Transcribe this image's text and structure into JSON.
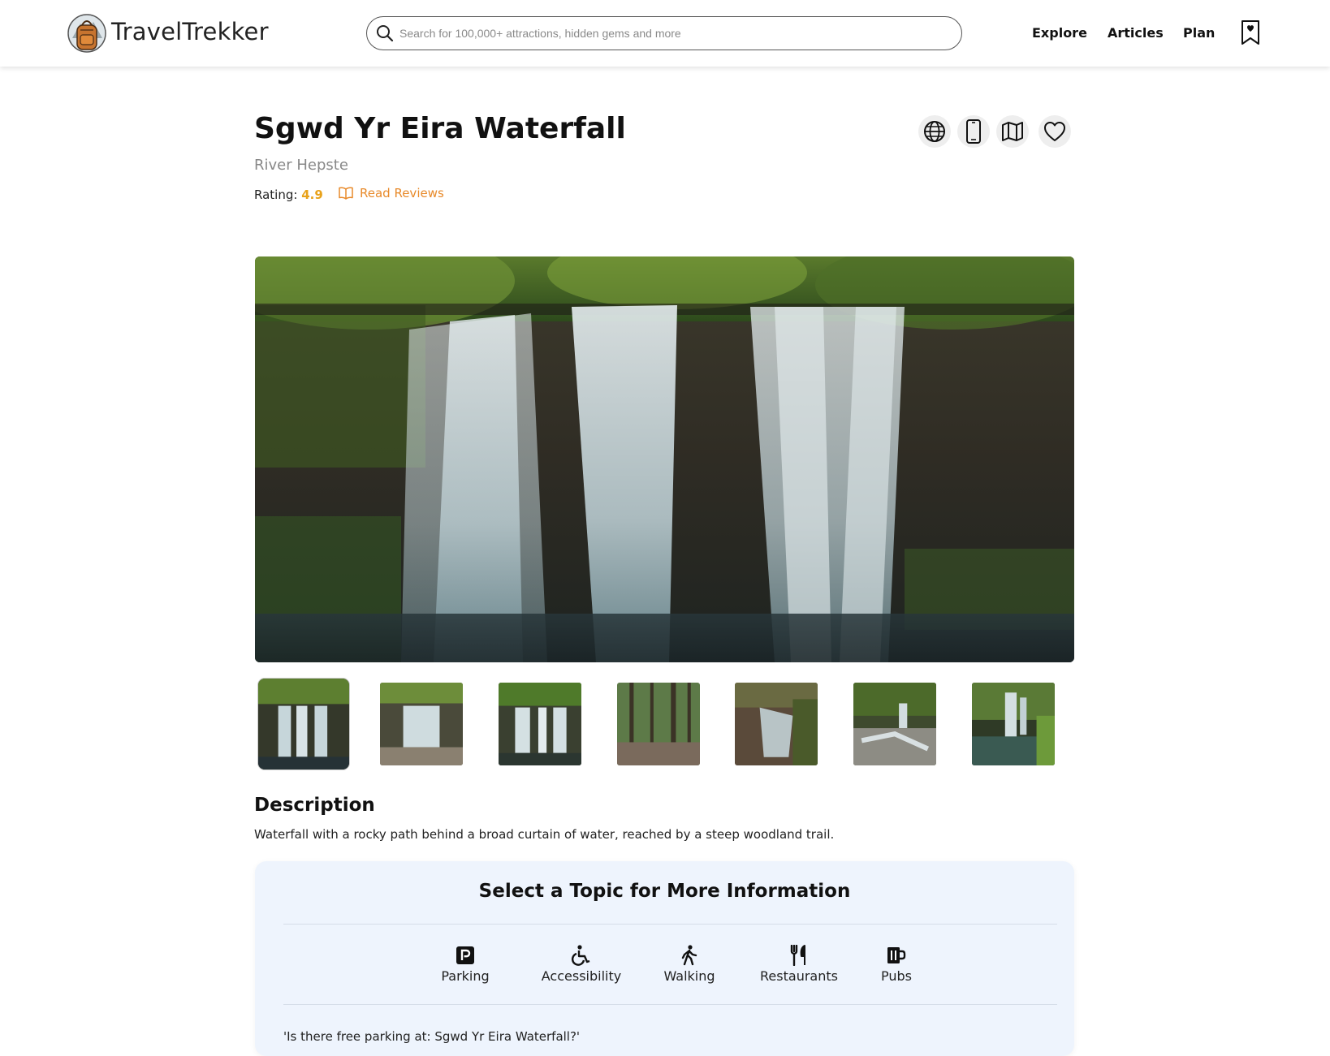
{
  "header": {
    "brand": "TravelTrekker",
    "search_placeholder": "Search for 100,000+ attractions, hidden gems and more",
    "nav": [
      "Explore",
      "Articles",
      "Plan"
    ]
  },
  "attraction": {
    "title": "Sgwd Yr Eira Waterfall",
    "subtitle": "River Hepste",
    "rating_label": "Rating:",
    "rating_value": "4.9",
    "reviews_label": "Read Reviews",
    "actions": [
      "globe-icon",
      "phone-icon",
      "map-icon",
      "heart-icon"
    ]
  },
  "gallery": {
    "thumbnail_count": 7,
    "active_index": 0
  },
  "description": {
    "heading": "Description",
    "text": "Waterfall with a rocky path behind a broad curtain of water, reached by a steep woodland trail."
  },
  "topics": {
    "heading": "Select a Topic for More Information",
    "items": [
      {
        "label": "Parking",
        "icon": "parking-icon"
      },
      {
        "label": "Accessibility",
        "icon": "wheelchair-icon"
      },
      {
        "label": "Walking",
        "icon": "walking-icon"
      },
      {
        "label": "Restaurants",
        "icon": "restaurant-icon"
      },
      {
        "label": "Pubs",
        "icon": "beer-mug-icon"
      }
    ],
    "question": "'Is there free parking at: Sgwd Yr Eira Waterfall?'"
  },
  "colors": {
    "rating": "#e8a21b",
    "reviews_link": "#e88a2a",
    "topic_panel_bg": "#eef4fd"
  }
}
